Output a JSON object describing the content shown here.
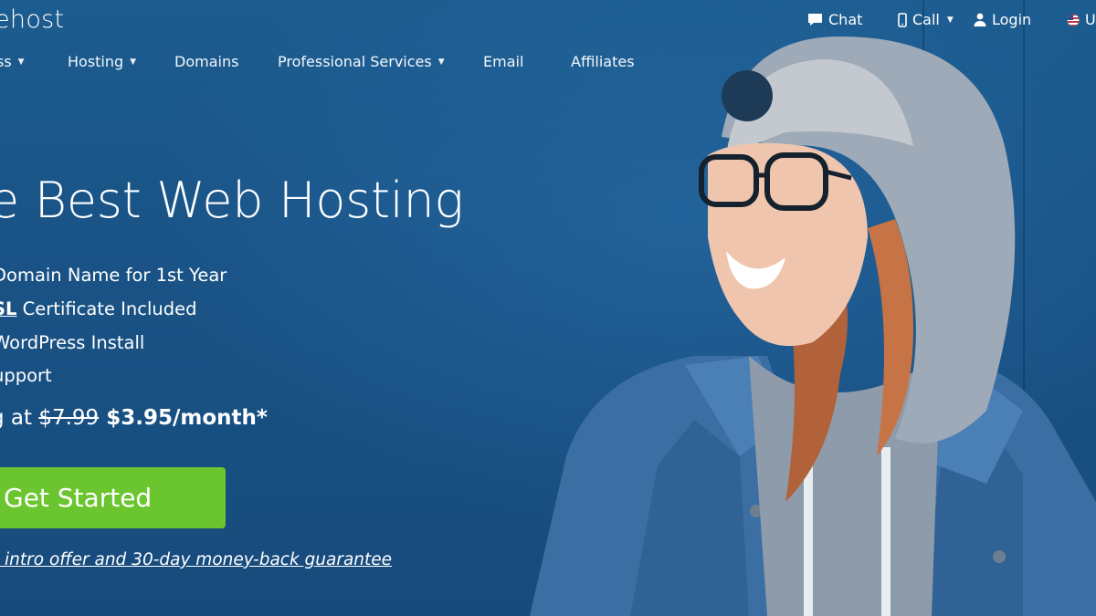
{
  "brand": {
    "logo_text": "ehost"
  },
  "utility": {
    "chat": "Chat",
    "call": "Call",
    "login": "Login",
    "locale": "U"
  },
  "nav": {
    "items": [
      {
        "label": "ss",
        "dropdown": true
      },
      {
        "label": "Hosting",
        "dropdown": true
      },
      {
        "label": "Domains",
        "dropdown": false
      },
      {
        "label": "Professional Services",
        "dropdown": true
      },
      {
        "label": "Email",
        "dropdown": false
      },
      {
        "label": "Affiliates",
        "dropdown": false
      }
    ]
  },
  "hero": {
    "headline": "e Best Web Hosting",
    "features": [
      {
        "prefix": "",
        "link": "",
        "text": "Domain Name for 1st Year"
      },
      {
        "prefix": "",
        "link": "SL",
        "text": " Certificate Included"
      },
      {
        "prefix": "",
        "link": "",
        "text": " WordPress Install"
      },
      {
        "prefix": "",
        "link": "",
        "text": "upport"
      }
    ],
    "price_prefix": "g at",
    "price_old": "$7.99",
    "price_new": "$3.95/month*",
    "cta_label": "Get Started",
    "guarantee": "l intro offer and 30-day money-back guarantee"
  },
  "colors": {
    "background": "#1a5386",
    "cta": "#6bc52e",
    "text": "#ffffff"
  },
  "icons": {
    "chat": "chat-bubble-icon",
    "call": "phone-icon",
    "login": "user-icon",
    "locale": "us-flag-icon"
  }
}
